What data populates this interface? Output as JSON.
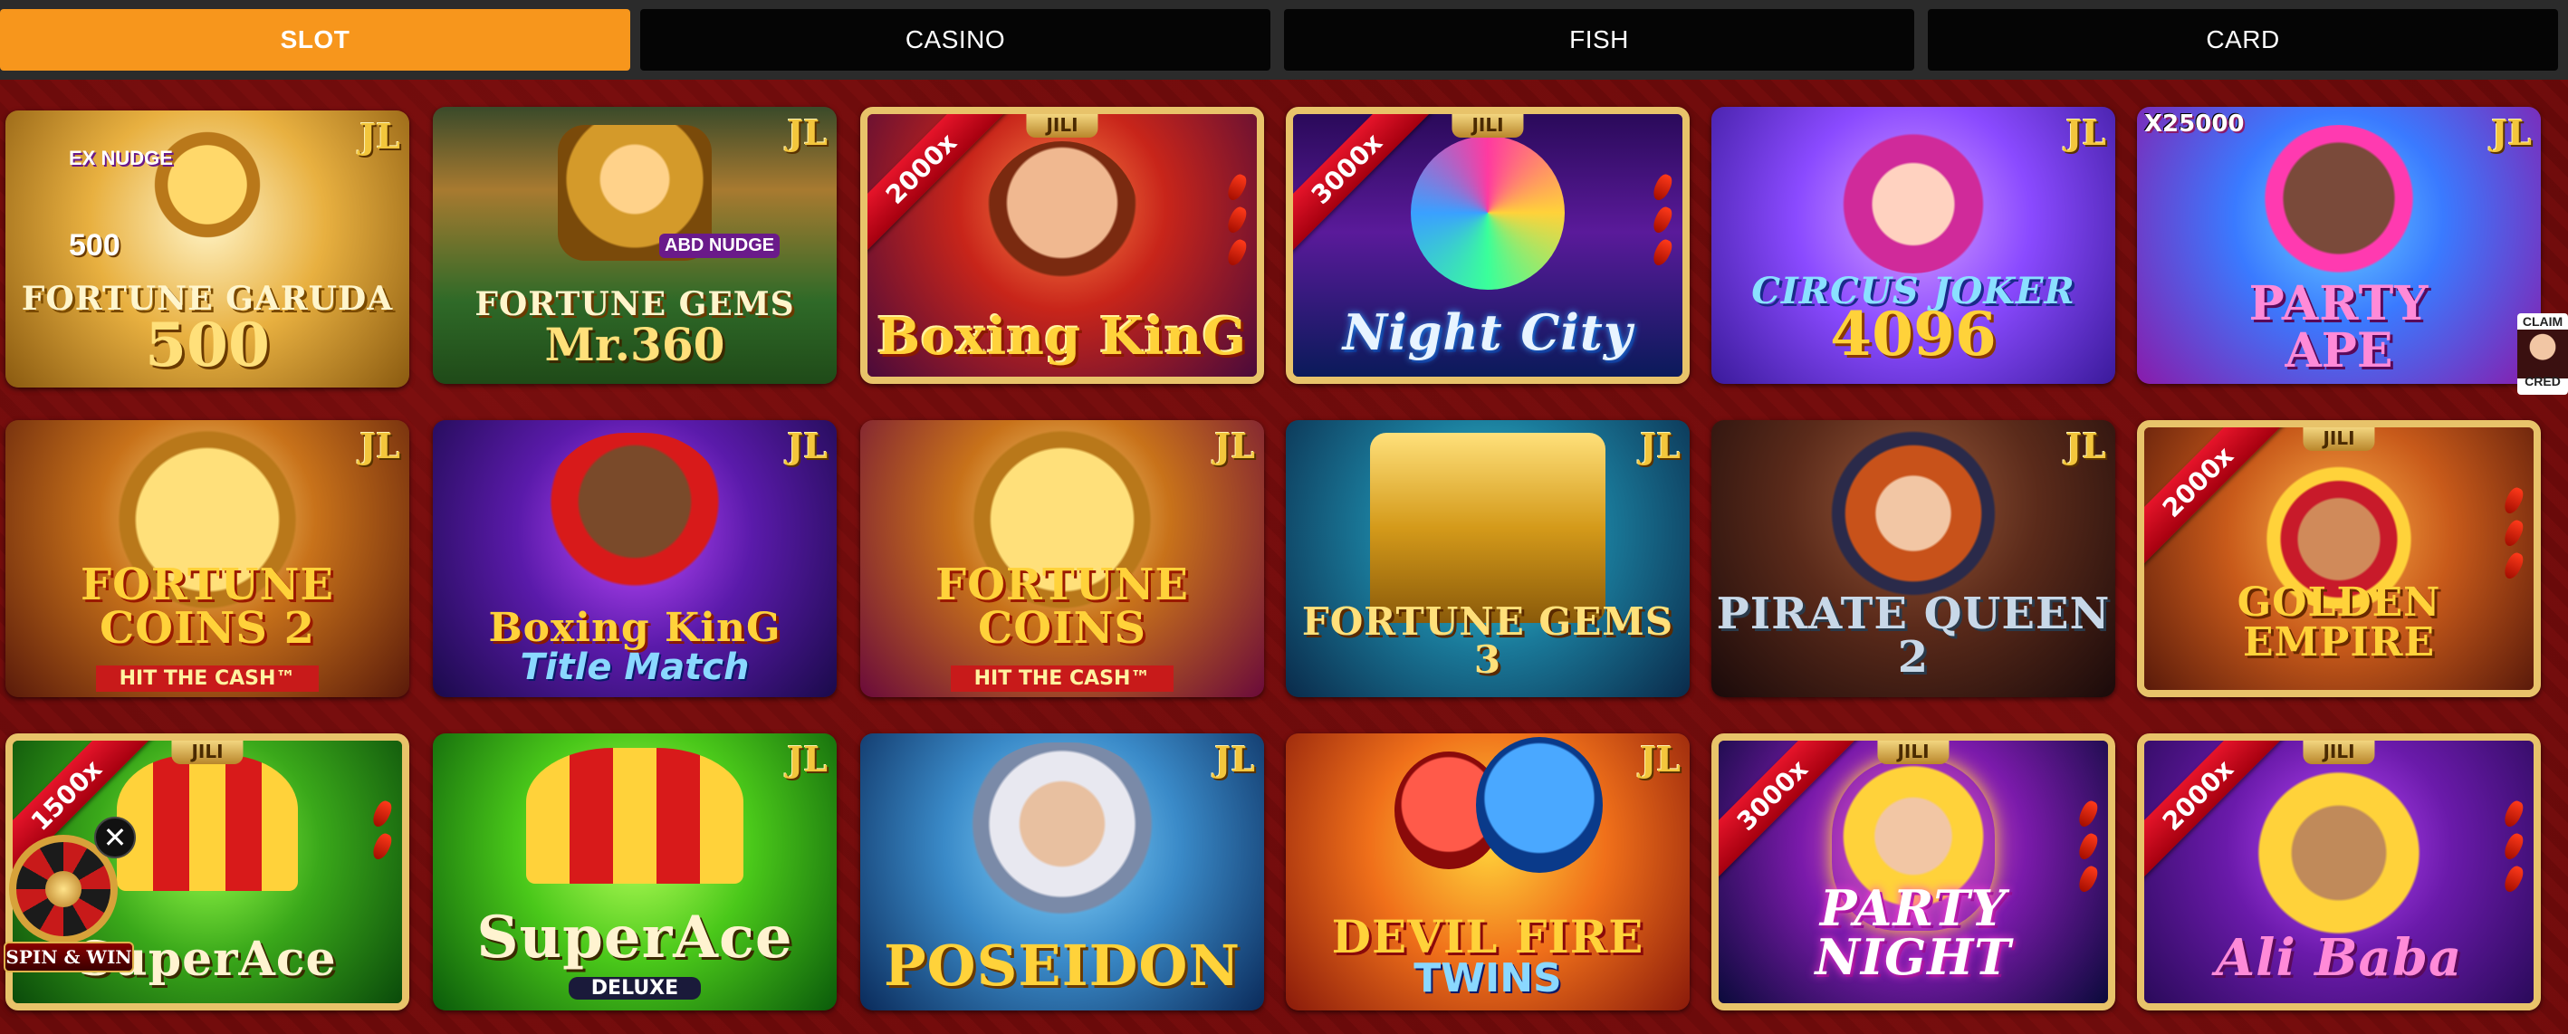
{
  "tabs": [
    {
      "label": "SLOT",
      "active": true
    },
    {
      "label": "CASINO",
      "active": false
    },
    {
      "label": "FISH",
      "active": false
    },
    {
      "label": "CARD",
      "active": false
    }
  ],
  "colors": {
    "accent": "#f7961c",
    "tab_bg": "#050505",
    "page_bg": "#5a0606"
  },
  "games": [
    {
      "title": "FORTUNE GARUDA",
      "subtitle": "500",
      "badge": "JL",
      "tag": "EX NUDGE",
      "tag2": "500"
    },
    {
      "title": "FORTUNE GEMS",
      "subtitle": "Mr.360",
      "badge": "JL",
      "tag": "ABD NUDGE"
    },
    {
      "title": "Boxing KinG",
      "badge": "JILI",
      "ribbon": "2000x"
    },
    {
      "title": "Night City",
      "badge": "JILI",
      "ribbon": "3000x"
    },
    {
      "title": "CIRCUS JOKER",
      "subtitle": "4096",
      "badge": "JL"
    },
    {
      "title": "PARTY",
      "subtitle": "APE",
      "badge": "JL",
      "tag": "X25000"
    },
    {
      "title": "FORTUNE COINS 2",
      "subtitle": "HIT THE CASH™",
      "badge": "JL"
    },
    {
      "title": "Boxing KinG",
      "subtitle": "Title Match",
      "badge": "JL"
    },
    {
      "title": "FORTUNE COINS",
      "subtitle": "HIT THE CASH™",
      "badge": "JL"
    },
    {
      "title": "FORTUNE GEMS 3",
      "badge": "JL"
    },
    {
      "title": "PIRATE QUEEN 2",
      "badge": "JL"
    },
    {
      "title": "GOLDEN EMPIRE",
      "badge": "JILI",
      "ribbon": "2000x"
    },
    {
      "title": "SuperAce",
      "badge": "JILI",
      "ribbon": "1500x"
    },
    {
      "title": "SuperAce",
      "subtitle": "DELUXE",
      "badge": "JL"
    },
    {
      "title": "POSEIDON",
      "badge": "JL"
    },
    {
      "title": "DEVIL FIRE",
      "subtitle": "TWINS",
      "badge": "JL"
    },
    {
      "title": "PARTY NIGHT",
      "badge": "JILI",
      "ribbon": "3000x"
    },
    {
      "title": "Ali Baba",
      "badge": "JILI",
      "ribbon": "2000x"
    }
  ],
  "overlays": {
    "spin_label": "SPIN & WIN",
    "close_symbol": "✕",
    "claim_top": "CLAIM",
    "claim_bottom": "CRED"
  }
}
